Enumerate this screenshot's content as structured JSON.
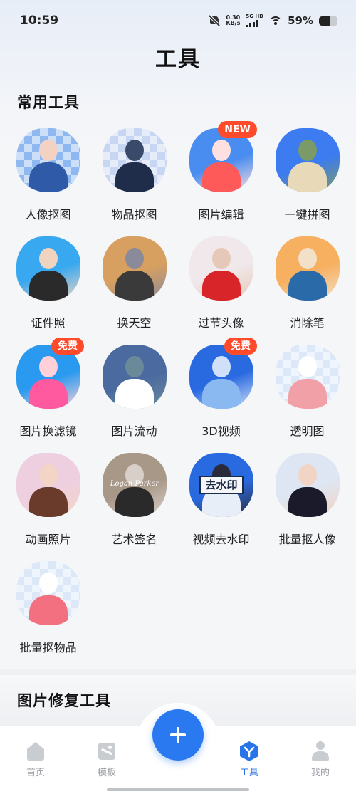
{
  "status_bar": {
    "time": "10:59",
    "net_speed_value": "0.30",
    "net_speed_unit": "KB/s",
    "signal_label": "5G HD",
    "battery_percent": "59%",
    "battery_level": 0.59
  },
  "page_title": "工具",
  "common_tools": {
    "title": "常用工具",
    "items": [
      {
        "label": "人像抠图",
        "icon": "portrait-cutout-icon",
        "badge": ""
      },
      {
        "label": "物品抠图",
        "icon": "object-cutout-icon",
        "badge": ""
      },
      {
        "label": "图片编辑",
        "icon": "image-edit-icon",
        "badge": "NEW"
      },
      {
        "label": "一键拼图",
        "icon": "collage-icon",
        "badge": ""
      },
      {
        "label": "证件照",
        "icon": "id-photo-icon",
        "badge": ""
      },
      {
        "label": "换天空",
        "icon": "sky-replace-icon",
        "badge": ""
      },
      {
        "label": "过节头像",
        "icon": "holiday-avatar-icon",
        "badge": ""
      },
      {
        "label": "消除笔",
        "icon": "eraser-pen-icon",
        "badge": ""
      },
      {
        "label": "图片换滤镜",
        "icon": "filter-icon",
        "badge": "免费"
      },
      {
        "label": "图片流动",
        "icon": "image-flow-icon",
        "badge": ""
      },
      {
        "label": "3D视频",
        "icon": "3d-video-icon",
        "badge": "免费"
      },
      {
        "label": "透明图",
        "icon": "transparent-image-icon",
        "badge": ""
      },
      {
        "label": "动画照片",
        "icon": "anime-photo-icon",
        "badge": ""
      },
      {
        "label": "艺术签名",
        "icon": "art-signature-icon",
        "badge": ""
      },
      {
        "label": "视频去水印",
        "icon": "video-watermark-remove-icon",
        "badge": ""
      },
      {
        "label": "批量抠人像",
        "icon": "batch-portrait-cutout-icon",
        "badge": ""
      },
      {
        "label": "批量抠物品",
        "icon": "batch-object-cutout-icon",
        "badge": ""
      }
    ]
  },
  "watermark_icon_text": "去水印",
  "signature_icon_text": "Logan Parker",
  "repair_tools": {
    "title": "图片修复工具"
  },
  "bottom_nav": {
    "items": [
      {
        "label": "首页",
        "icon": "home-icon"
      },
      {
        "label": "模板",
        "icon": "template-icon"
      },
      {
        "label": "工具",
        "icon": "tools-icon"
      },
      {
        "label": "我的",
        "icon": "profile-icon"
      }
    ],
    "active": "工具"
  },
  "colors": {
    "accent": "#2a79f0",
    "badge": "#ff4b2b",
    "nav_inactive": "#9a9da3"
  }
}
